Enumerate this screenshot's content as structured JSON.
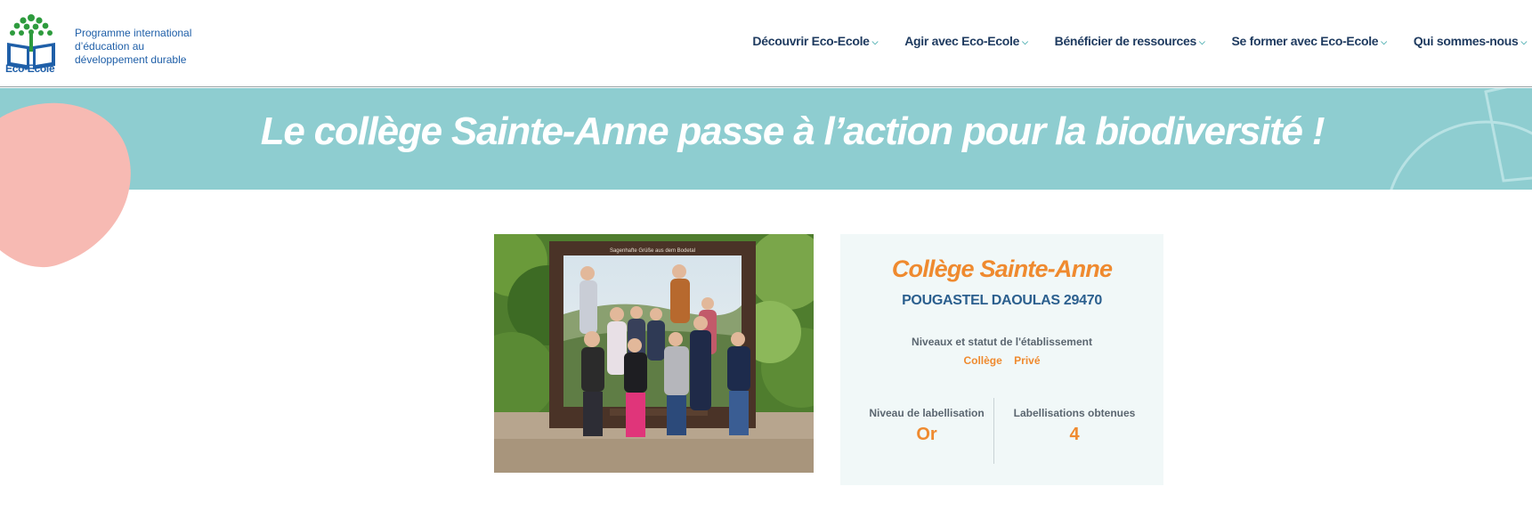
{
  "header": {
    "logo_label": "Eco-Ecole",
    "tagline_lines": [
      "Programme international",
      "d’éducation au",
      "développement durable"
    ]
  },
  "nav": {
    "items": [
      {
        "label": "Découvrir Eco-Ecole"
      },
      {
        "label": "Agir avec Eco-Ecole"
      },
      {
        "label": "Bénéficier de ressources"
      },
      {
        "label": "Se former avec Eco-Ecole"
      },
      {
        "label": "Qui sommes-nous"
      }
    ],
    "chevron_icon": "chevron-down-icon"
  },
  "banner": {
    "title": "Le collège Sainte-Anne passe à l’action pour la biodiversité !"
  },
  "photo": {
    "sign_text": "Sagenhafte Grüße aus dem Bodetal"
  },
  "card": {
    "name": "Collège Sainte-Anne",
    "city": "POUGASTEL DAOULAS 29470",
    "levels_label": "Niveaux et statut de l'établissement",
    "levels": [
      "Collège",
      "Privé"
    ],
    "stats": [
      {
        "label": "Niveau de labellisation",
        "value": "Or"
      },
      {
        "label": "Labellisations obtenues",
        "value": "4"
      }
    ]
  },
  "colors": {
    "banner": "#8ecdd0",
    "accent_orange": "#ef8a2f",
    "nav_text": "#1e3a5f",
    "blob_pink": "#f7bab3"
  }
}
